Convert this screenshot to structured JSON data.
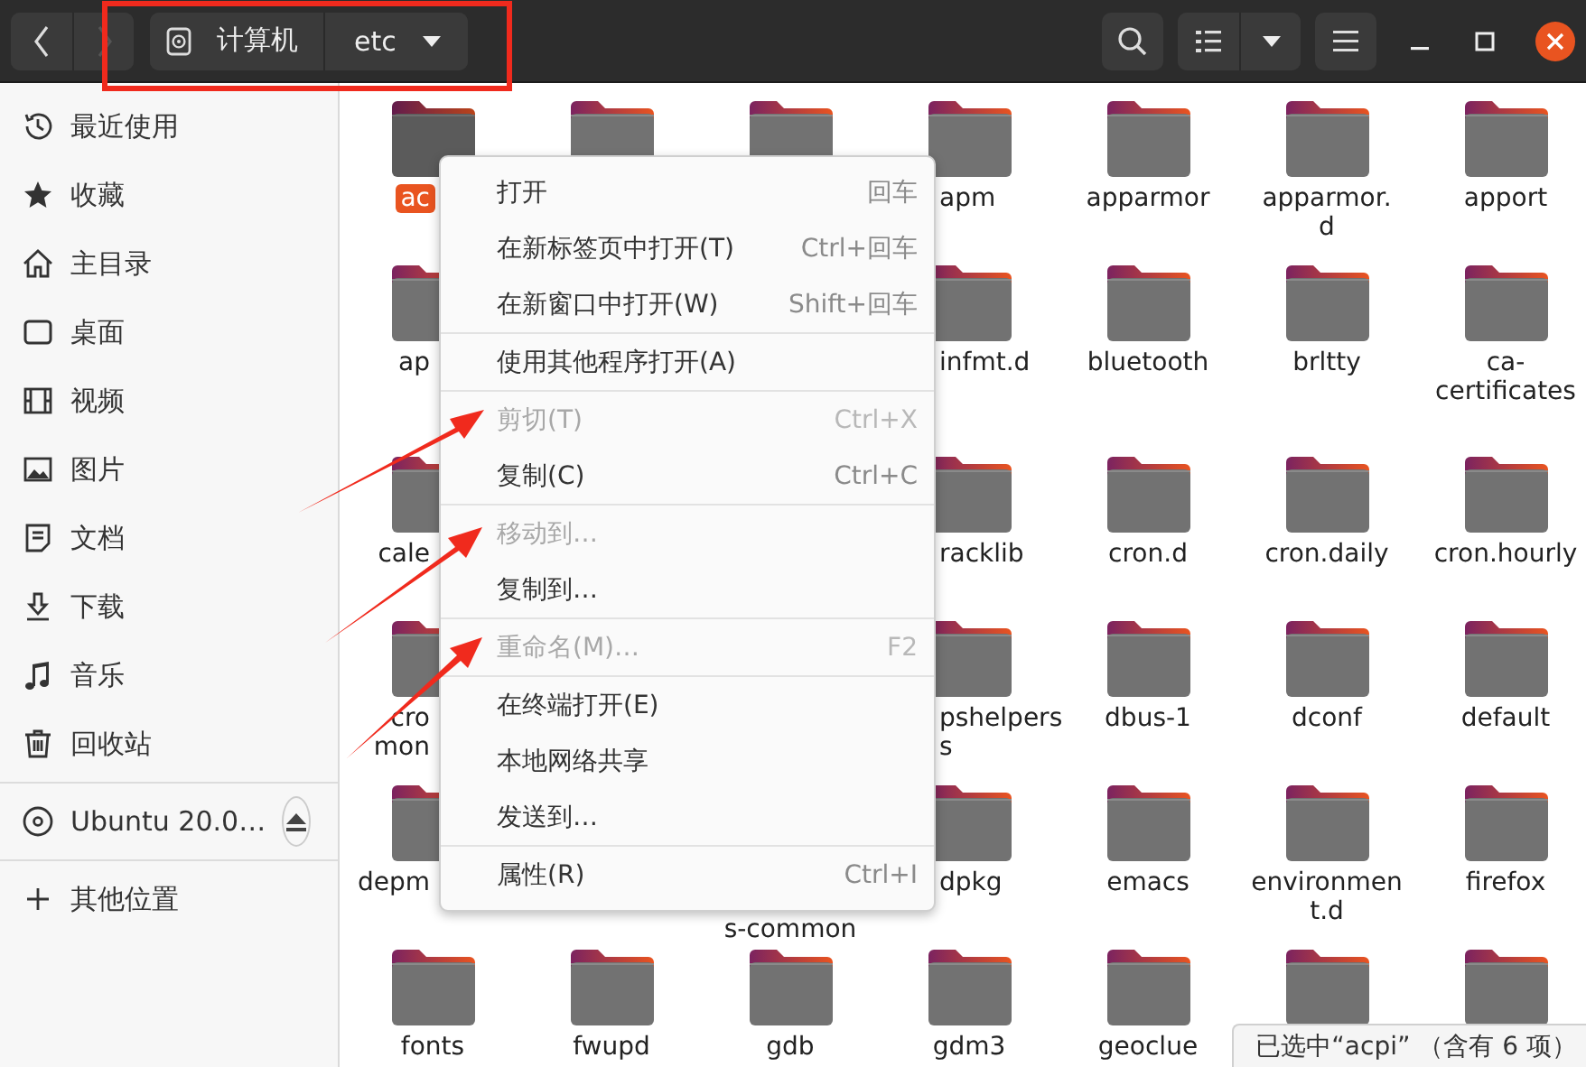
{
  "header": {
    "back": {
      "disabled": false
    },
    "forward": {
      "disabled": true
    },
    "path": [
      {
        "label": "计算机"
      },
      {
        "label": "etc"
      }
    ]
  },
  "sidebar": {
    "places": [
      {
        "label": "最近使用"
      },
      {
        "label": "收藏"
      },
      {
        "label": "主目录"
      },
      {
        "label": "桌面"
      },
      {
        "label": "视频"
      },
      {
        "label": "图片"
      },
      {
        "label": "文档"
      },
      {
        "label": "下载"
      },
      {
        "label": "音乐"
      },
      {
        "label": "回收站"
      }
    ],
    "devices": [
      {
        "label": "Ubuntu 20.0…"
      }
    ],
    "other": [
      {
        "label": "其他位置"
      }
    ]
  },
  "files": [
    {
      "lines": [
        "ac"
      ],
      "selected": true
    },
    {
      "selected": false
    },
    {
      "selected": false
    },
    {
      "lines": [
        "apm"
      ],
      "selected": false
    },
    {
      "lines": [
        "apparmor"
      ],
      "selected": false
    },
    {
      "lines": [
        "apparmor.",
        "d"
      ],
      "selected": false
    },
    {
      "lines": [
        "apport"
      ],
      "selected": false
    },
    {
      "lines": [
        "ap"
      ],
      "selected": false
    },
    {
      "lines": [
        "infmt.d"
      ],
      "selected": false
    },
    {
      "lines": [
        "bluetooth"
      ],
      "selected": false
    },
    {
      "lines": [
        "brltty"
      ],
      "selected": false
    },
    {
      "lines": [
        "ca-",
        "certificates"
      ],
      "selected": false
    },
    {
      "lines": [
        "cale"
      ],
      "selected": false
    },
    {
      "lines": [
        "racklib"
      ],
      "selected": false
    },
    {
      "lines": [
        "cron.d"
      ],
      "selected": false
    },
    {
      "lines": [
        "cron.daily"
      ],
      "selected": false
    },
    {
      "lines": [
        "cron.hourly"
      ],
      "selected": false
    },
    {
      "lines": [
        "cro",
        "mon"
      ],
      "selected": false
    },
    {
      "lines": [
        "pshelpers",
        "s"
      ],
      "selected": false
    },
    {
      "lines": [
        "dbus-1"
      ],
      "selected": false
    },
    {
      "lines": [
        "dconf"
      ],
      "selected": false
    },
    {
      "lines": [
        "default"
      ],
      "selected": false
    },
    {
      "lines": [
        "depm"
      ],
      "selected": false
    },
    {
      "lines": [
        "s-common"
      ],
      "selected": false
    },
    {
      "lines": [
        "dpkg"
      ],
      "selected": false
    },
    {
      "lines": [
        "emacs"
      ],
      "selected": false
    },
    {
      "lines": [
        "environmen",
        "t.d"
      ],
      "selected": false
    },
    {
      "lines": [
        "firefox"
      ],
      "selected": false
    },
    {
      "lines": [
        "fonts"
      ],
      "selected": false
    },
    {
      "lines": [
        "fwupd"
      ],
      "selected": false
    },
    {
      "lines": [
        "gdb"
      ],
      "selected": false
    },
    {
      "lines": [
        "gdm3"
      ],
      "selected": false
    },
    {
      "lines": [
        "geoclue"
      ],
      "selected": false
    },
    {
      "selected": false
    },
    {
      "selected": false
    }
  ],
  "context_menu": {
    "groups": [
      [
        {
          "label": "打开",
          "shortcut": "回车",
          "disabled": false
        },
        {
          "label": "在新标签页中打开(T)",
          "shortcut": "Ctrl+回车",
          "disabled": false
        },
        {
          "label": "在新窗口中打开(W)",
          "shortcut": "Shift+回车",
          "disabled": false
        }
      ],
      [
        {
          "label": "使用其他程序打开(A)",
          "disabled": false
        }
      ],
      [
        {
          "label": "剪切(T)",
          "shortcut": "Ctrl+X",
          "disabled": true
        },
        {
          "label": "复制(C)",
          "shortcut": "Ctrl+C",
          "disabled": false
        }
      ],
      [
        {
          "label": "移动到…",
          "disabled": true
        },
        {
          "label": "复制到…",
          "disabled": false
        }
      ],
      [
        {
          "label": "重命名(M)…",
          "shortcut": "F2",
          "disabled": true
        }
      ],
      [
        {
          "label": "在终端打开(E)",
          "disabled": false
        },
        {
          "label": "本地网络共享",
          "disabled": false
        },
        {
          "label": "发送到…",
          "disabled": false
        }
      ],
      [
        {
          "label": "属性(R)",
          "shortcut": "Ctrl+I",
          "disabled": false
        }
      ]
    ]
  },
  "status": "已选中“acpi” （含有 6 项）"
}
